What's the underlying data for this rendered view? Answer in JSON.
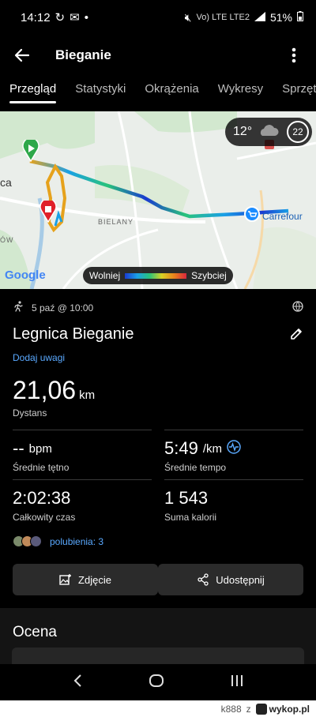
{
  "status": {
    "time": "14:12",
    "network": "Vo) LTE LTE2",
    "battery": "51%"
  },
  "app_bar": {
    "title": "Bieganie"
  },
  "tabs": [
    {
      "label": "Przegląd",
      "active": true
    },
    {
      "label": "Statystyki",
      "active": false
    },
    {
      "label": "Okrążenia",
      "active": false
    },
    {
      "label": "Wykresy",
      "active": false
    },
    {
      "label": "Sprzęt",
      "active": false
    }
  ],
  "map": {
    "weather_temp": "12°",
    "weather_badge": "22",
    "label_district": "BIELANY",
    "label_store": "Carrefour",
    "label_city_partial": "ca",
    "label_west_partial": "ÓW",
    "speed_slow": "Wolniej",
    "speed_fast": "Szybciej",
    "provider": "Google"
  },
  "activity": {
    "date": "5 paź @ 10:00",
    "title": "Legnica Bieganie",
    "add_note": "Dodaj uwagi",
    "distance_value": "21,06",
    "distance_unit": "km",
    "distance_label": "Dystans",
    "hr_value": "--",
    "hr_unit": "bpm",
    "hr_label": "Średnie tętno",
    "pace_value": "5:49",
    "pace_unit": "/km",
    "pace_label": "Średnie tempo",
    "time_value": "2:02:38",
    "time_label": "Całkowity czas",
    "calories_value": "1 543",
    "calories_label": "Suma kalorii",
    "likes": "polubienia: 3"
  },
  "buttons": {
    "photo": "Zdjęcie",
    "share": "Udostępnij"
  },
  "rating": {
    "title": "Ocena"
  },
  "watermark": {
    "user": "k888",
    "sep": "z",
    "site": "wykop.pl"
  },
  "colors": {
    "accent_link": "#5aa9ff",
    "background": "#000000",
    "button_bg": "#2b2b2b",
    "route_start": "#2ea84a",
    "route_end": "#e0202a"
  }
}
